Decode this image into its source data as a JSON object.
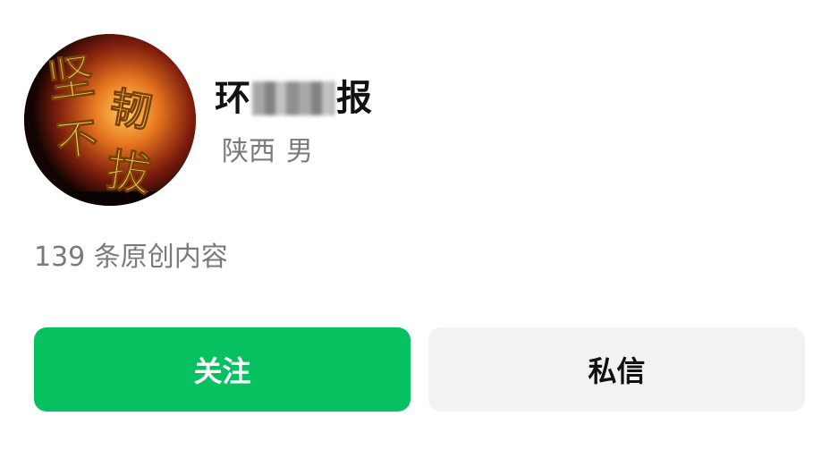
{
  "profile": {
    "avatar": {
      "icon": "calligraphy-avatar",
      "calligraphy_text": "坚韧不拔",
      "colors": {
        "glow": "#f7b23a",
        "fire": "#d8611b",
        "dark": "#2a0a05",
        "text": "#f1c44a"
      }
    },
    "name_start": "环",
    "name_end": "报",
    "region": "陕西",
    "gender": "男"
  },
  "stats": {
    "original_posts": "139 条原创内容"
  },
  "actions": {
    "follow_label": "关注",
    "message_label": "私信"
  },
  "colors": {
    "follow_bg": "#07c160",
    "message_bg": "#f2f2f2",
    "meta_text": "#7a7a7a"
  }
}
